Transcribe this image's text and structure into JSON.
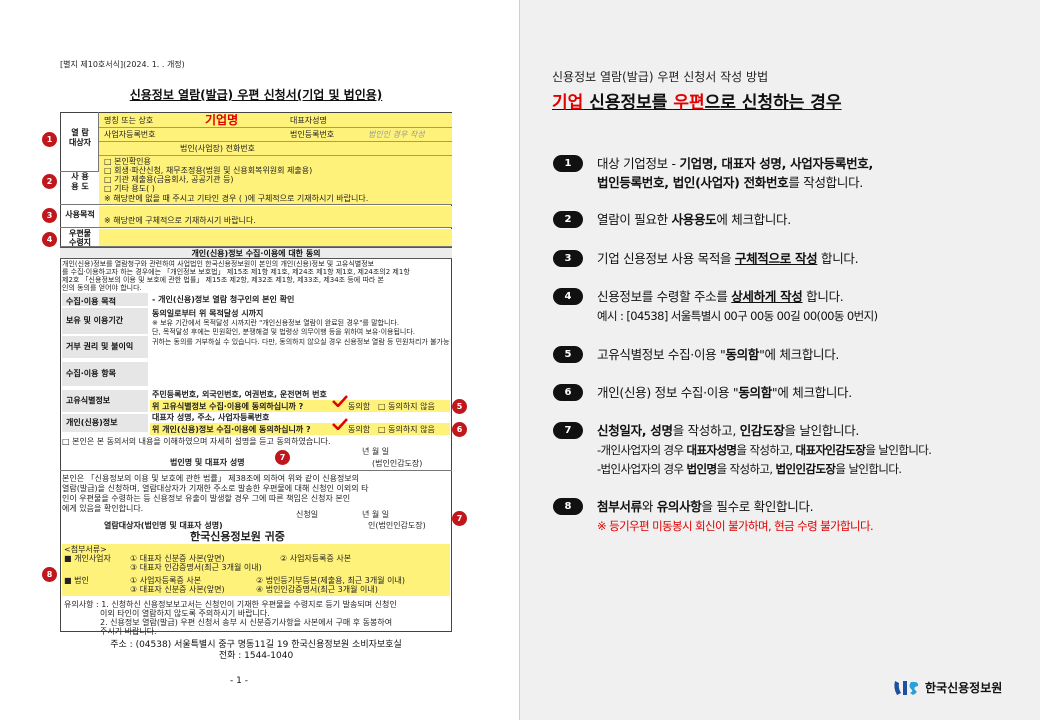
{
  "form": {
    "code": "[별지 제10호서식](2024. 1.   . 개정)",
    "title": "신용정보 열람(발급) 우편 신청서(기업 및 법인용)",
    "target": {
      "label_a": "열  람",
      "label_b": "대상자",
      "name_label": "명칭 또는 상호",
      "name_value": "기업명",
      "ceo_label": "대표자성명",
      "bizno_label": "사업자등록번호",
      "corpno_label": "법인등록번호",
      "corpno_hint": "법인인 경우 작성",
      "phone_label": "법인(사업장) 전화번호"
    },
    "usage": {
      "label_a": "사  용",
      "label_b": "용  도",
      "options": [
        "□ 본인확인용",
        "□ 회생·파산신청, 채무조정용(법원 및 신용회복위원회 제출용)",
        "□ 기관 제출용(금융회사, 공공기관 등)",
        "□ 기타 용도(                                    )",
        "※ 해당란에 없을 때 주시고 기타인 경우 (  )에 구체적으로 기재하시기 바랍니다."
      ]
    },
    "purpose": {
      "label": "사용목적",
      "hint": "※ 해당란에 구체적으로 기재하시기 바랍니다."
    },
    "delivery": {
      "label_a": "우편물",
      "label_b": "수령지"
    },
    "consent_header": "개인(신용)정보 수집·이용에 대한 동의",
    "consent_intro": [
      "개인(신용)정보를 열람청구와 관련하여 사업법인 한국신용정보원이 본인의 개인(신용)정보 및 고유식별정보",
      "를 수집·이용하고자 하는 경우에는 「개인정보 보호법」 제15조 제1항 제1호, 제24조 제1항 제1호, 제24조의2 제1항",
      "제2호 「신용정보의 이용 및 보호에 관한 법률」 제15조 제2항, 제32조 제1항, 제33조, 제34조 등에 따라 본",
      "인의 동의를 얻어야 합니다."
    ],
    "consent_rows": [
      {
        "label": "수집·이용 목적",
        "value": "- 개인(신용)정보 열람 청구인의 본인 확인"
      },
      {
        "label": "보유 및 이용기간",
        "value": "동의일로부터 위 목적달성 시까지",
        "sub": "※ 보유 기간에서 목적달성 시까지란 \"개인신용정보 열람이 완료된 경우\"를 말합니다."
      },
      {
        "label": "거부 권리 및 불이익",
        "value": "단, 목적달성 후에는 민원확인, 분쟁해결 및 법령상 의무이행 등을 위하여 보유·이용됩니다.",
        "sub": "귀하는 동의를 거부하실 수 있습니다. 다만, 동의하지 않으실 경우 신용정보 열람 등 민원처리가 불가능합니다."
      }
    ],
    "collect_items_label": "수집·이용 항목",
    "unique_id": {
      "label": "고유식별정보",
      "items": "주민등록번호, 외국인번호, 여권번호, 운전면허 번호",
      "question": "위 고유식별정보 수집·이용에 동의하십니까 ?",
      "agree": "동의함",
      "disagree": "□ 동의하지 않음"
    },
    "personal": {
      "label": "개인(신용)정보",
      "items_a": "대표자 성명, 주소, 사업자등록번호",
      "items_b": "위 개인(신용)정보 수집·이용에 동의하십니까 ?",
      "agree": "동의함",
      "disagree": "□ 동의하지 않음"
    },
    "consent_confirm": "□ 본인은 본 동의서의 내용을 이해하였으며 자세히 설명을 듣고 동의하였습니다.",
    "sign_date": "년     월     일",
    "sign_label": "법인명 및 대표자 성명",
    "sign_seal": "(법인인감도장)",
    "request_text": [
      "본인은 「신용정보의 이용 및 보호에 관한 법률」 제38조에 의하여 위와 같이 신용정보의",
      "열람(발급)을 신청하며, 열람대상자가 기재한 주소로 발송한 우편물에 대해 신청인 이외의 타",
      "인이 우편물을 수령하는 등 신용정보 유출이 발생할 경우 그에 따른 책임은 신청자 본인",
      "에게 있음을 확인합니다."
    ],
    "apply_date_label": "신청일",
    "apply_date": "년     월     일",
    "applicant_label": "열람대상자(법인명 및 대표자 성명)",
    "applicant_seal": "인(법인인감도장)",
    "recipient": "한국신용정보원 귀중",
    "attachments": {
      "title": "<첨부서류>",
      "personal_label": "■ 개인사업자",
      "personal_items": [
        "① 대표자 신분증 사본(앞면)",
        "② 사업자등록증 사본",
        "③ 대표자 인감증명서(최근 3개월 이내)"
      ],
      "corp_label": "■ 법인",
      "corp_items": [
        "① 사업자등록증 사본",
        "② 법인등기부등본(제출용, 최근 3개월 이내)",
        "③ 대표자 신분증 사본(앞면)",
        "④ 법인인감증명서(최근 3개월 이내)"
      ]
    },
    "notes": [
      "유의사항 : 1. 신청하신 신용정보보고서는 신청인이 기재한 우편물을 수령지로 등기 발송되며 신청인",
      "이외 타인이 열람하지 않도록 주의하시기 바랍니다.",
      "2. 신용정보 열람(발급) 우편 신청서 송부 시 신분증기사항을 사본에서 구매 후 동봉하여",
      "주시기 바랍니다."
    ],
    "address": "주소 : (04538) 서울특별시 중구 명동11길 19  한국신용정보원 소비자보호실",
    "phone": "전화 : 1544-1040",
    "page": "- 1 -",
    "markers": [
      "1",
      "2",
      "3",
      "4",
      "5",
      "6",
      "7",
      "7",
      "8"
    ]
  },
  "guide": {
    "subtitle": "신용정보 열람(발급) 우편 신청서 작성 방법",
    "title_red1": "기업",
    "title_mid1": " 신용정보를 ",
    "title_red2": "우편",
    "title_mid2": "으로 신청하는 경우",
    "steps": [
      {
        "num": "1",
        "a": "대상 기업정보 - ",
        "b": "기업명, 대표자 성명, 사업자등록번호,",
        "c": "법인등록번호, 법인(사업자) 전화번호",
        "d": "를 작성합니다."
      },
      {
        "num": "2",
        "a": "열람이 필요한 ",
        "b": "사용용도",
        "c": "에 체크합니다."
      },
      {
        "num": "3",
        "a": "기업 신용정보 사용 목적을 ",
        "b": "구체적으로 작성",
        "c": " 합니다."
      },
      {
        "num": "4",
        "a": "신용정보를 수령할 주소를 ",
        "b": "상세하게 작성",
        "c": " 합니다.",
        "d": "예시 : [04538] 서울특별시 00구 00동 00길 00(00동 0번지)"
      },
      {
        "num": "5",
        "a": "고유식별정보 수집·이용 \"",
        "b": "동의함",
        "c": "\"에 체크합니다."
      },
      {
        "num": "6",
        "a": "개인(신용) 정보 수집·이용 \"",
        "b": "동의함",
        "c": "\"에 체크합니다."
      },
      {
        "num": "7",
        "a": "신청일자, 성명",
        "b": "을 작성하고, ",
        "c": "인감도장",
        "d": "을 날인합니다.",
        "e1": "-개인사업자의 경우 ",
        "e2": "대표자성명",
        "e3": "을 작성하고, ",
        "e4": "대표자인감도장",
        "e5": "을 날인합니다.",
        "f1": "-법인사업자의 경우 ",
        "f2": "법인명",
        "f3": "을 작성하고, ",
        "f4": "법인인감도장",
        "f5": "을 날인합니다."
      },
      {
        "num": "8",
        "a": "첨부서류",
        "b": "와 ",
        "c": "유의사항",
        "d": "을 필수로 확인합니다.",
        "e": "※ 등기우편 미동봉시 회신이 불가하며, 현금 수령 불가합니다."
      }
    ],
    "logo_text": "한국신용정보원"
  },
  "colors": {
    "accent_red": "#e00000",
    "marker_red": "#c0171d",
    "highlight": "#fff27a"
  },
  "icons": {
    "check": "check-mark-icon",
    "logo": "kcis-logo-icon"
  }
}
